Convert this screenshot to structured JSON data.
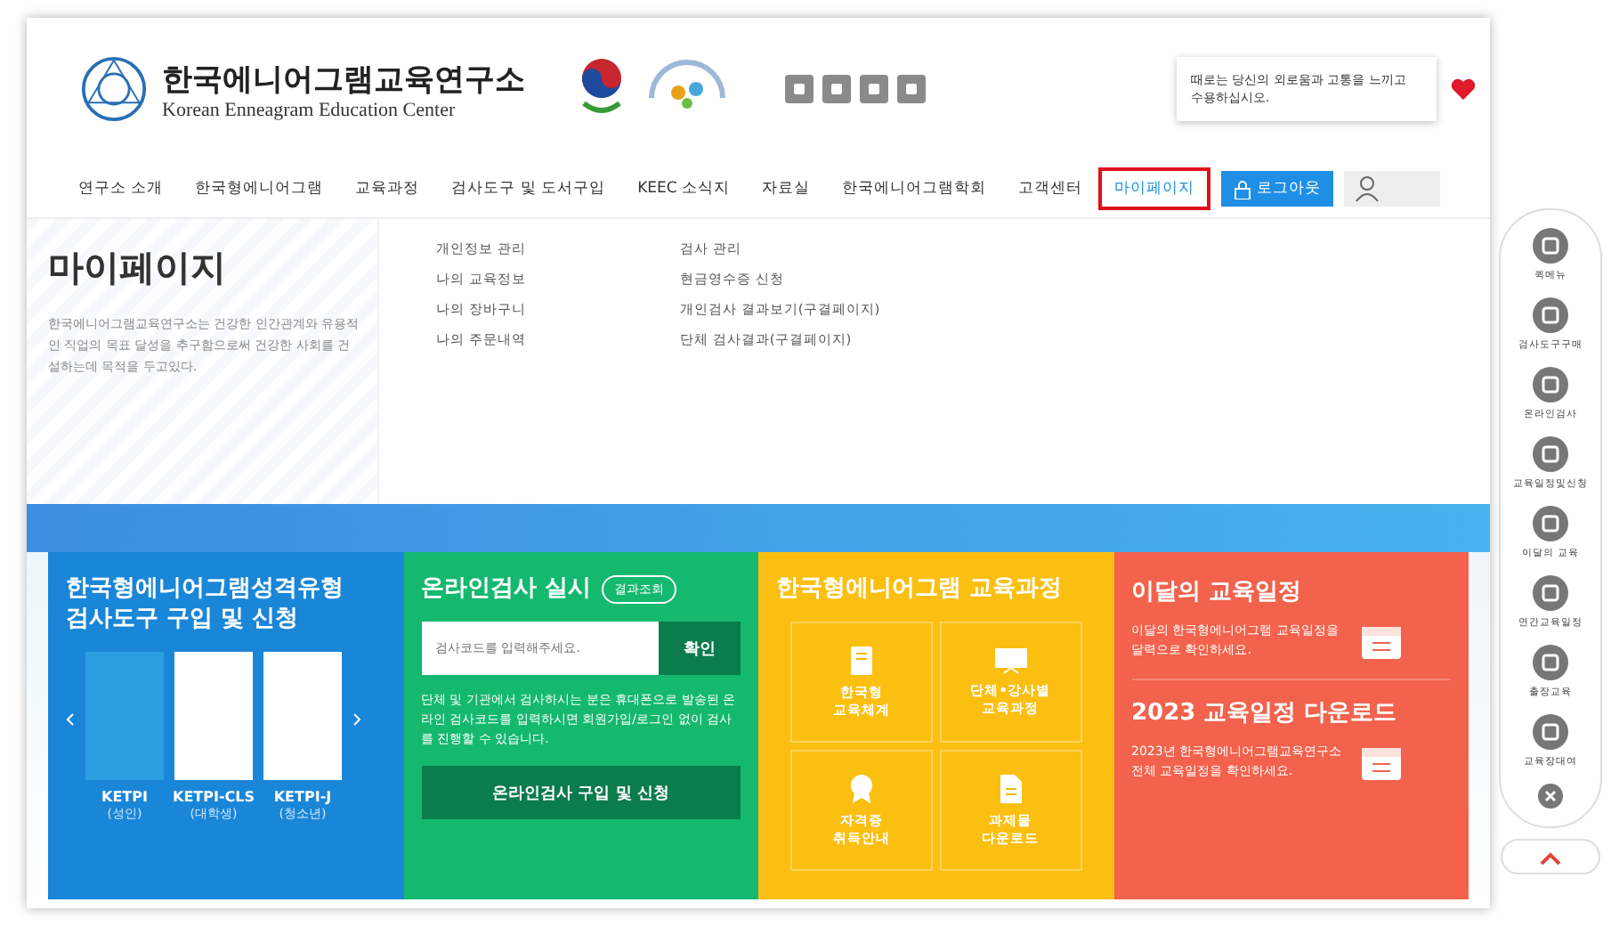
{
  "header": {
    "logo_title": "한국에니어그램교육연구소",
    "logo_subtitle": "Korean Enneagram Education Center",
    "tooltip": "때로는 당신의 외로움과 고통을 느끼고 수용하십시오."
  },
  "nav": {
    "items": [
      {
        "label": "연구소 소개",
        "selected": false
      },
      {
        "label": "한국형에니어그램",
        "selected": false
      },
      {
        "label": "교육과정",
        "selected": false
      },
      {
        "label": "검사도구 및 도서구입",
        "selected": false
      },
      {
        "label": "KEEC 소식지",
        "selected": false
      },
      {
        "label": "자료실",
        "selected": false
      },
      {
        "label": "한국에니어그램학회",
        "selected": false
      },
      {
        "label": "고객센터",
        "selected": false
      },
      {
        "label": "마이페이지",
        "selected": true
      }
    ],
    "login_button": "로그아웃"
  },
  "mypage_menu": {
    "title": "마이페이지",
    "description": "한국에니어그램교육연구소는 건강한 인간관계와 유용적인 직업의 목표 달성을 추구함으로써 건강한 사회를 건설하는데 목적을 두고있다.",
    "links_1": [
      "개인정보 관리",
      "나의 교육정보",
      "나의 장바구니",
      "나의 주문내역"
    ],
    "links_2": [
      "검사 관리",
      "현금영수증 신청",
      "개인검사 결과보기(구결페이지)",
      "단체 검사결과(구결페이지)"
    ]
  },
  "test_tools": {
    "title": "한국형에니어그램성격유형\n검사도구 구입 및 신청",
    "products": [
      {
        "name": "KETPI",
        "audience": "(성인)",
        "color": "#2b9fe0"
      },
      {
        "name": "KETPI-CLS",
        "audience": "(대학생)",
        "color": "#ffffff"
      },
      {
        "name": "KETPI-J",
        "audience": "(청소년)",
        "color": "#ffffff"
      }
    ]
  },
  "online_test": {
    "title": "온라인검사 실시",
    "result_button": "결과조회",
    "code_placeholder": "검사코드를 입력해주세요.",
    "confirm_button": "확인",
    "notice": "단체 및 기관에서 검사하시는 분은 휴대폰으로 발송된 온라인 검사코드를 입력하시면 회원가입/로그인 없이 검사를 진행할 수 있습니다.",
    "buy_button": "온라인검사 구입 및 신청"
  },
  "courses": {
    "title": "한국형에니어그램 교육과정",
    "tiles": [
      {
        "label": "한국형\n교육체계",
        "kind": "book"
      },
      {
        "label": "단체•강사별\n교육과정",
        "kind": "screen"
      },
      {
        "label": "자격증\n취득안내",
        "kind": "badge"
      },
      {
        "label": "과제물\n다운로드",
        "kind": "file"
      }
    ]
  },
  "schedule": {
    "items": [
      {
        "title": "이달의 교육일정",
        "text": "이달의 한국형에니어그램 교육일정을 달력으로 확인하세요."
      },
      {
        "title": "2023 교육일정 다운로드",
        "text": "2023년 한국형에니어그램교육연구소 전체 교육일정을 확인하세요."
      }
    ]
  },
  "quick_menu": {
    "items": [
      "퀵메뉴",
      "검사도구구매",
      "온라인검사",
      "교육일정및신청",
      "이달의 교육",
      "연간교육일정",
      "출장교육",
      "교육장대여"
    ]
  }
}
